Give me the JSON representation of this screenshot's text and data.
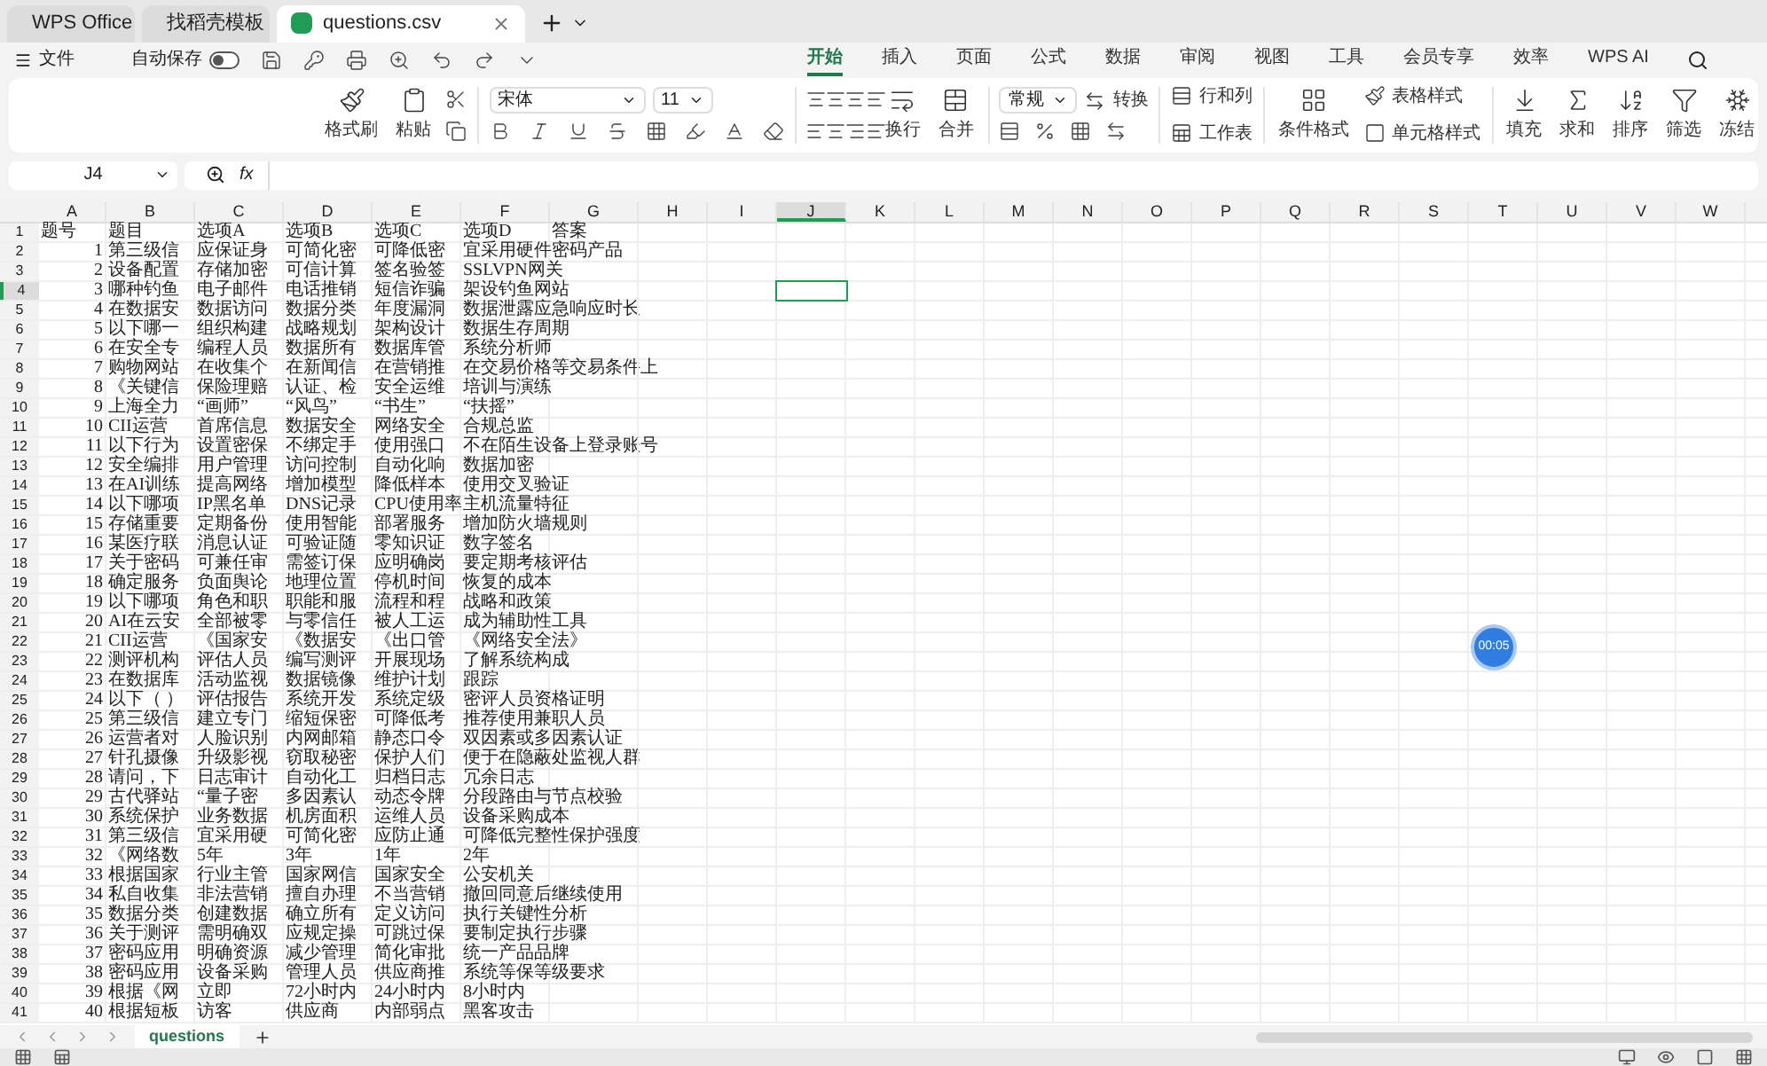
{
  "browser_tabs": [
    {
      "label": "WPS Office",
      "kind": "home",
      "selected": false
    },
    {
      "label": "找稻壳模板",
      "kind": "template",
      "selected": false
    },
    {
      "label": "questions.csv",
      "kind": "sheet",
      "selected": true
    }
  ],
  "toolbar": {
    "file_menu": "文件",
    "autosave_label": "自动保存",
    "autosave_on": false
  },
  "ribbon_tabs": [
    {
      "label": "开始",
      "selected": true
    },
    {
      "label": "插入",
      "selected": false
    },
    {
      "label": "页面",
      "selected": false
    },
    {
      "label": "公式",
      "selected": false
    },
    {
      "label": "数据",
      "selected": false
    },
    {
      "label": "审阅",
      "selected": false
    },
    {
      "label": "视图",
      "selected": false
    },
    {
      "label": "工具",
      "selected": false
    },
    {
      "label": "会员专享",
      "selected": false
    },
    {
      "label": "效率",
      "selected": false
    },
    {
      "label": "WPS AI",
      "selected": false
    }
  ],
  "ribbon": {
    "format_painter": "格式刷",
    "paste": "粘贴",
    "font": "宋体",
    "font_size": "11",
    "wrap": "换行",
    "merge": "合并",
    "number_format": "常规",
    "convert": "转换",
    "rows_cols": "行和列",
    "worksheet": "工作表",
    "conditional": "条件格式",
    "table_style": "表格样式",
    "cell_style": "单元格样式",
    "fill": "填充",
    "sum": "求和",
    "sort": "排序",
    "filter": "筛选",
    "freeze": "冻结"
  },
  "name_box": "J4",
  "formula_label": "fx",
  "columns": [
    {
      "label": "A",
      "selected": false
    },
    {
      "label": "B",
      "selected": false
    },
    {
      "label": "C",
      "selected": false
    },
    {
      "label": "D",
      "selected": false
    },
    {
      "label": "E",
      "selected": false
    },
    {
      "label": "F",
      "selected": false
    },
    {
      "label": "G",
      "selected": false
    },
    {
      "label": "H",
      "selected": false
    },
    {
      "label": "I",
      "selected": false
    },
    {
      "label": "J",
      "selected": true
    },
    {
      "label": "K",
      "selected": false
    },
    {
      "label": "L",
      "selected": false
    },
    {
      "label": "M",
      "selected": false
    },
    {
      "label": "N",
      "selected": false
    },
    {
      "label": "O",
      "selected": false
    },
    {
      "label": "P",
      "selected": false
    },
    {
      "label": "Q",
      "selected": false
    },
    {
      "label": "R",
      "selected": false
    },
    {
      "label": "S",
      "selected": false
    },
    {
      "label": "T",
      "selected": false
    },
    {
      "label": "U",
      "selected": false
    },
    {
      "label": "V",
      "selected": false
    },
    {
      "label": "W",
      "selected": false
    }
  ],
  "rows": [
    {
      "number": "1",
      "selected": false,
      "cells": [
        "题号",
        "题目",
        "选项A",
        "选项B",
        "选项C",
        "选项D",
        "答案"
      ]
    },
    {
      "number": "2",
      "selected": false,
      "cells": [
        "1",
        "第三级信",
        "应保证身",
        "可简化密",
        "可降低密",
        "宜采用硬件密码产品"
      ]
    },
    {
      "number": "3",
      "selected": false,
      "cells": [
        "2",
        "设备配置",
        "存储加密",
        "可信计算",
        "签名验签",
        "SSLVPN网关"
      ]
    },
    {
      "number": "4",
      "selected": true,
      "cells": [
        "3",
        "哪种钓鱼",
        "电子邮件",
        "电话推销",
        "短信诈骗",
        "架设钓鱼网站"
      ]
    },
    {
      "number": "5",
      "selected": false,
      "cells": [
        "4",
        "在数据安",
        "数据访问",
        "数据分类",
        "年度漏洞",
        "数据泄露应急响应时长"
      ]
    },
    {
      "number": "6",
      "selected": false,
      "cells": [
        "5",
        "以下哪一",
        "组织构建",
        "战略规划",
        "架构设计",
        "数据生存周期"
      ]
    },
    {
      "number": "7",
      "selected": false,
      "cells": [
        "6",
        "在安全专",
        "编程人员",
        "数据所有",
        "数据库管",
        "系统分析师"
      ]
    },
    {
      "number": "8",
      "selected": false,
      "cells": [
        "7",
        "购物网站",
        "在收集个",
        "在新闻信",
        "在营销推",
        "在交易价格等交易条件上"
      ]
    },
    {
      "number": "9",
      "selected": false,
      "cells": [
        "8",
        "《关键信",
        "保险理赔",
        "认证、检",
        "安全运维",
        "培训与演练"
      ]
    },
    {
      "number": "10",
      "selected": false,
      "cells": [
        "9",
        "上海全力",
        "“画师”",
        "“风鸟”",
        "“书生”",
        "“扶摇”"
      ]
    },
    {
      "number": "11",
      "selected": false,
      "cells": [
        "10",
        "CII运营",
        "首席信息",
        "数据安全",
        "网络安全",
        "合规总监"
      ]
    },
    {
      "number": "12",
      "selected": false,
      "cells": [
        "11",
        "以下行为",
        "设置密保",
        "不绑定手",
        "使用强口",
        "不在陌生设备上登录账号"
      ]
    },
    {
      "number": "13",
      "selected": false,
      "cells": [
        "12",
        "安全编排",
        "用户管理",
        "访问控制",
        "自动化响",
        "数据加密"
      ]
    },
    {
      "number": "14",
      "selected": false,
      "cells": [
        "13",
        "在AI训练",
        "提高网络",
        "增加模型",
        "降低样本",
        "使用交叉验证"
      ]
    },
    {
      "number": "15",
      "selected": false,
      "cells": [
        "14",
        "以下哪项",
        "IP黑名单",
        "DNS记录",
        "CPU使用率",
        "主机流量特征"
      ]
    },
    {
      "number": "16",
      "selected": false,
      "cells": [
        "15",
        "存储重要",
        "定期备份",
        "使用智能",
        "部署服务",
        "增加防火墙规则"
      ]
    },
    {
      "number": "17",
      "selected": false,
      "cells": [
        "16",
        "某医疗联",
        "消息认证",
        "可验证随",
        "零知识证",
        "数字签名"
      ]
    },
    {
      "number": "18",
      "selected": false,
      "cells": [
        "17",
        "关于密码",
        "可兼任审",
        "需签订保",
        "应明确岗",
        "要定期考核评估"
      ]
    },
    {
      "number": "19",
      "selected": false,
      "cells": [
        "18",
        "确定服务",
        "负面舆论",
        "地理位置",
        "停机时间",
        "恢复的成本"
      ]
    },
    {
      "number": "20",
      "selected": false,
      "cells": [
        "19",
        "以下哪项",
        "角色和职",
        "职能和服",
        "流程和程",
        "战略和政策"
      ]
    },
    {
      "number": "21",
      "selected": false,
      "cells": [
        "20",
        "AI在云安",
        "全部被零",
        "与零信任",
        "被人工运",
        "成为辅助性工具"
      ]
    },
    {
      "number": "22",
      "selected": false,
      "cells": [
        "21",
        "CII运营",
        "《国家安",
        "《数据安",
        "《出口管",
        "《网络安全法》"
      ]
    },
    {
      "number": "23",
      "selected": false,
      "cells": [
        "22",
        "测评机构",
        "评估人员",
        "编写测评",
        "开展现场",
        "了解系统构成"
      ]
    },
    {
      "number": "24",
      "selected": false,
      "cells": [
        "23",
        "在数据库",
        "活动监视",
        "数据镜像",
        "维护计划",
        "跟踪"
      ]
    },
    {
      "number": "25",
      "selected": false,
      "cells": [
        "24",
        "以下（ ）",
        "评估报告",
        "系统开发",
        "系统定级",
        "密评人员资格证明"
      ]
    },
    {
      "number": "26",
      "selected": false,
      "cells": [
        "25",
        "第三级信",
        "建立专门",
        "缩短保密",
        "可降低考",
        "推荐使用兼职人员"
      ]
    },
    {
      "number": "27",
      "selected": false,
      "cells": [
        "26",
        "运营者对",
        "人脸识别",
        "内网邮箱",
        "静态口令",
        "双因素或多因素认证"
      ]
    },
    {
      "number": "28",
      "selected": false,
      "cells": [
        "27",
        "针孔摄像",
        "升级影视",
        "窃取秘密",
        "保护人们",
        "便于在隐蔽处监视人群"
      ]
    },
    {
      "number": "29",
      "selected": false,
      "cells": [
        "28",
        "请问，下",
        "日志审计",
        "自动化工",
        "归档日志",
        "冗余日志"
      ]
    },
    {
      "number": "30",
      "selected": false,
      "cells": [
        "29",
        "古代驿站",
        "“量子密",
        "多因素认",
        "动态令牌",
        "分段路由与节点校验"
      ]
    },
    {
      "number": "31",
      "selected": false,
      "cells": [
        "30",
        "系统保护",
        "业务数据",
        "机房面积",
        "运维人员",
        "设备采购成本"
      ]
    },
    {
      "number": "32",
      "selected": false,
      "cells": [
        "31",
        "第三级信",
        "宜采用硬",
        "可简化密",
        "应防止通",
        "可降低完整性保护强度"
      ]
    },
    {
      "number": "33",
      "selected": false,
      "cells": [
        "32",
        "《网络数",
        "5年",
        "3年",
        "1年",
        "2年"
      ]
    },
    {
      "number": "34",
      "selected": false,
      "cells": [
        "33",
        "根据国家",
        "行业主管",
        "国家网信",
        "国家安全",
        "公安机关"
      ]
    },
    {
      "number": "35",
      "selected": false,
      "cells": [
        "34",
        "私自收集",
        "非法营销",
        "擅自办理",
        "不当营销",
        "撤回同意后继续使用"
      ]
    },
    {
      "number": "36",
      "selected": false,
      "cells": [
        "35",
        "数据分类",
        "创建数据",
        "确立所有",
        "定义访问",
        "执行关键性分析"
      ]
    },
    {
      "number": "37",
      "selected": false,
      "cells": [
        "36",
        "关于测评",
        "需明确双",
        "应规定操",
        "可跳过保",
        "要制定执行步骤"
      ]
    },
    {
      "number": "38",
      "selected": false,
      "cells": [
        "37",
        "密码应用",
        "明确资源",
        "减少管理",
        "简化审批",
        "统一产品品牌"
      ]
    },
    {
      "number": "39",
      "selected": false,
      "cells": [
        "38",
        "密码应用",
        "设备采购",
        "管理人员",
        "供应商推",
        "系统等保等级要求"
      ]
    },
    {
      "number": "40",
      "selected": false,
      "cells": [
        "39",
        "根据《网",
        "立即",
        "72小时内",
        "24小时内",
        "8小时内"
      ]
    },
    {
      "number": "41",
      "selected": false,
      "cells": [
        "40",
        "根据短板",
        "访客",
        "供应商",
        "内部弱点",
        "黑客攻击"
      ]
    }
  ],
  "sheet_tabs": [
    {
      "label": "questions",
      "selected": true
    }
  ],
  "timer": "00:05"
}
